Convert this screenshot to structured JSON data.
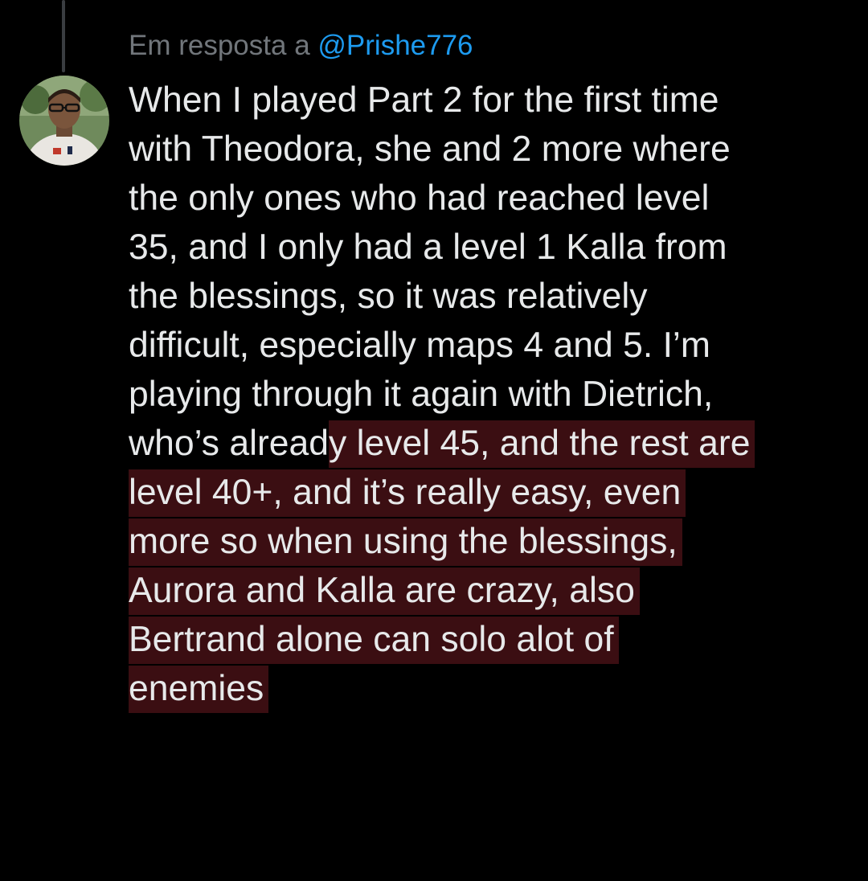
{
  "reply": {
    "prefix": "Em resposta a",
    "handle": "@Prishe776"
  },
  "tweet": {
    "lines": [
      {
        "plain": "When I played Part 2 for the first time",
        "highlight": ""
      },
      {
        "plain": "with Theodora, she and 2 more where",
        "highlight": ""
      },
      {
        "plain": "the only ones who had reached level",
        "highlight": ""
      },
      {
        "plain": "35, and I only had a level 1 Kalla from",
        "highlight": ""
      },
      {
        "plain": "the blessings, so it was relatively",
        "highlight": ""
      },
      {
        "plain": "difficult, especially maps 4 and 5. I’m",
        "highlight": ""
      },
      {
        "plain": "playing through it again with Dietrich,",
        "highlight": ""
      },
      {
        "plain": "who’s alread",
        "highlight": "y level 45, and the rest are"
      },
      {
        "plain": "",
        "highlight": "level 40+, and it’s really easy, even"
      },
      {
        "plain": "",
        "highlight": "more so when using the blessings,"
      },
      {
        "plain": "",
        "highlight": "Aurora and Kalla are crazy, also"
      },
      {
        "plain": "",
        "highlight": "Bertrand alone can solo alot of"
      },
      {
        "plain": "",
        "highlight": "enemies"
      }
    ]
  },
  "colors": {
    "background": "#000000",
    "text": "#e7e9ea",
    "muted": "#71767b",
    "link": "#1d9bf0",
    "highlight": "#3b0e12",
    "thread_line": "#3a3d41"
  }
}
